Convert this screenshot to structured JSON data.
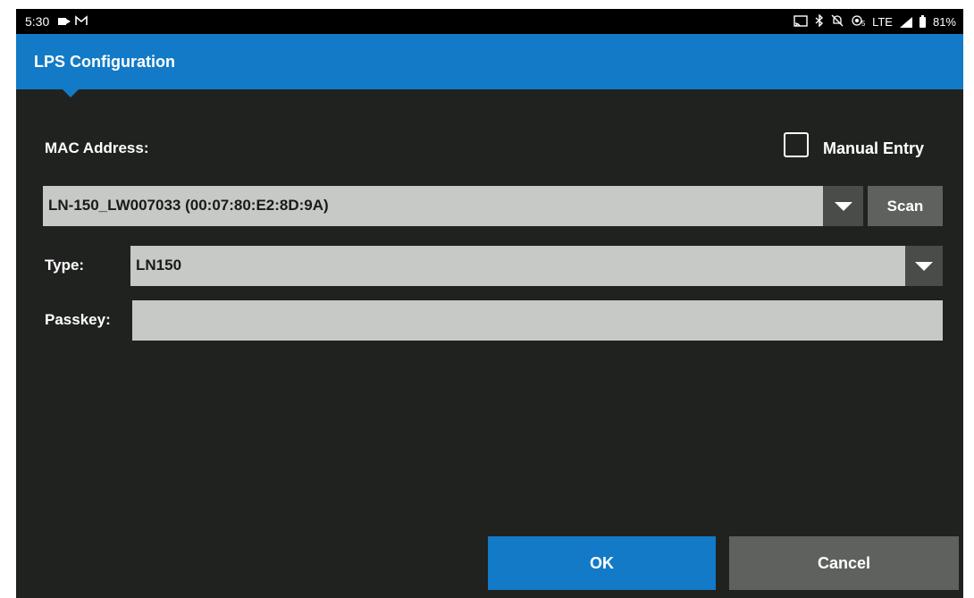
{
  "status_bar": {
    "time": "5:30",
    "lte_label": "LTE",
    "battery": "81%"
  },
  "app_bar": {
    "title": "LPS Configuration"
  },
  "form": {
    "mac_label": "MAC Address:",
    "manual_entry_label": "Manual Entry",
    "manual_entry_checked": false,
    "mac_value": "LN-150_LW007033 (00:07:80:E2:8D:9A)",
    "scan_label": "Scan",
    "type_label": "Type:",
    "type_value": "LN150",
    "passkey_label": "Passkey:",
    "passkey_value": ""
  },
  "buttons": {
    "ok_label": "OK",
    "cancel_label": "Cancel"
  },
  "colors": {
    "accent": "#127ac6",
    "background": "#202220",
    "field": "#c6c9c5",
    "secondary_button": "#5e615e"
  },
  "icons": [
    "video-camera-icon",
    "gmail-icon",
    "cast-icon",
    "bluetooth-icon",
    "mute-icon",
    "hotspot-icon",
    "signal-icon",
    "battery-icon",
    "dropdown-arrow-icon",
    "checkbox-icon"
  ]
}
